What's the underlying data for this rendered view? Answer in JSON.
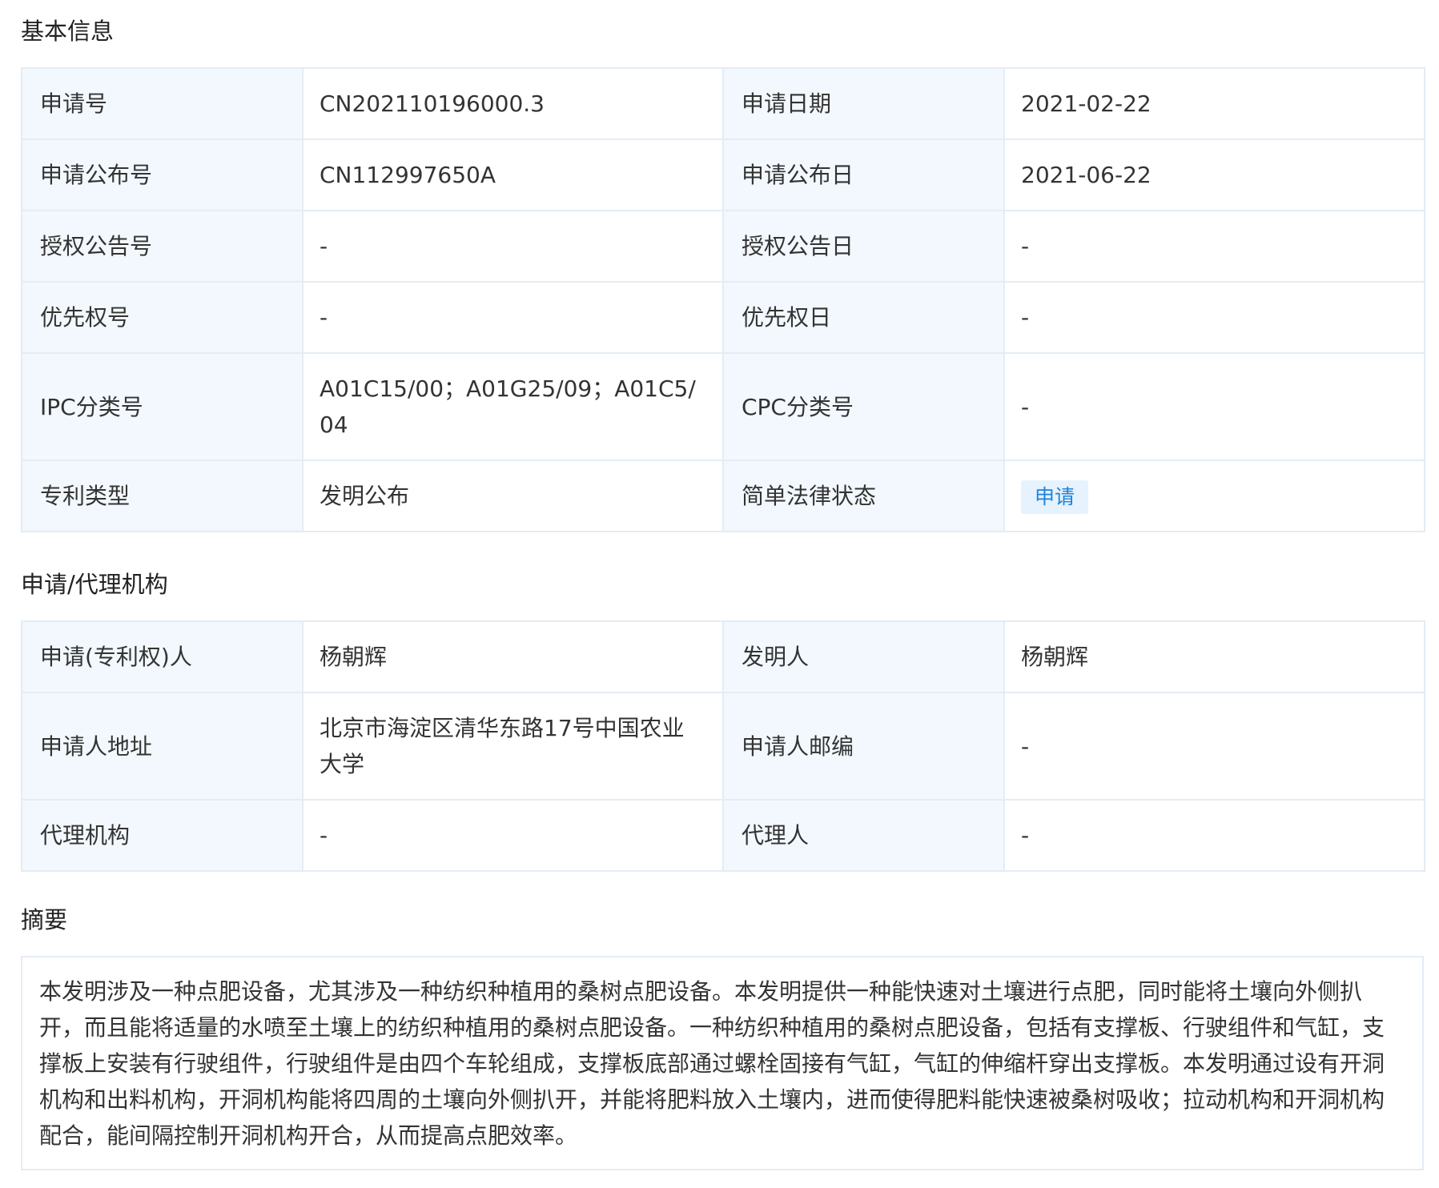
{
  "sections": {
    "basic": "基本信息",
    "agency": "申请/代理机构",
    "abstract": "摘要"
  },
  "basic_info": {
    "rows": [
      {
        "l1": "申请号",
        "v1": "CN202110196000.3",
        "l2": "申请日期",
        "v2": "2021-02-22"
      },
      {
        "l1": "申请公布号",
        "v1": "CN112997650A",
        "l2": "申请公布日",
        "v2": "2021-06-22"
      },
      {
        "l1": "授权公告号",
        "v1": "-",
        "l2": "授权公告日",
        "v2": "-"
      },
      {
        "l1": "优先权号",
        "v1": "-",
        "l2": "优先权日",
        "v2": "-"
      },
      {
        "l1": "IPC分类号",
        "v1": "A01C15/00；A01G25/09；A01C5/04",
        "l2": "CPC分类号",
        "v2": "-"
      },
      {
        "l1": "专利类型",
        "v1": "发明公布",
        "l2": "简单法律状态",
        "v2": "申请"
      }
    ]
  },
  "agency_info": {
    "rows": [
      {
        "l1": "申请(专利权)人",
        "v1": "杨朝辉",
        "l2": "发明人",
        "v2": "杨朝辉"
      },
      {
        "l1": "申请人地址",
        "v1": "北京市海淀区清华东路17号中国农业大学",
        "l2": "申请人邮编",
        "v2": "-"
      },
      {
        "l1": "代理机构",
        "v1": "-",
        "l2": "代理人",
        "v2": "-"
      }
    ]
  },
  "abstract_text": "本发明涉及一种点肥设备，尤其涉及一种纺织种植用的桑树点肥设备。本发明提供一种能快速对土壤进行点肥，同时能将土壤向外侧扒开，而且能将适量的水喷至土壤上的纺织种植用的桑树点肥设备。一种纺织种植用的桑树点肥设备，包括有支撑板、行驶组件和气缸，支撑板上安装有行驶组件，行驶组件是由四个车轮组成，支撑板底部通过螺栓固接有气缸，气缸的伸缩杆穿出支撑板。本发明通过设有开洞机构和出料机构，开洞机构能将四周的土壤向外侧扒开，并能将肥料放入土壤内，进而使得肥料能快速被桑树吸收；拉动机构和开洞机构配合，能间隔控制开洞机构开合，从而提高点肥效率。",
  "colors": {
    "label_bg": "#f2f8fd",
    "border": "#e4ecf4",
    "badge_bg": "#e6f2fd",
    "badge_text": "#1f83d9"
  }
}
